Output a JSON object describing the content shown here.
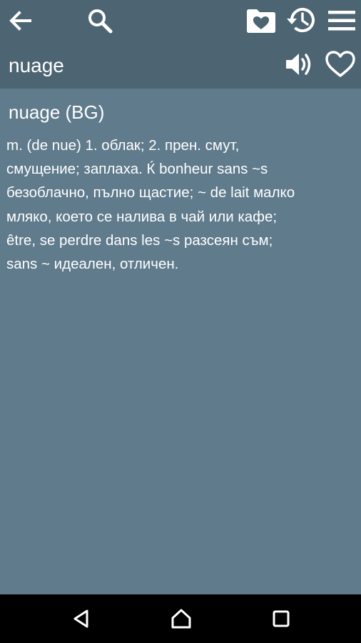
{
  "toolbar": {
    "word": "nuage",
    "icons": [
      "back-arrow-icon",
      "search-icon",
      "folder-heart-icon",
      "history-icon",
      "menu-icon",
      "speaker-icon",
      "heart-icon"
    ]
  },
  "entry": {
    "title": "nuage (BG)",
    "lines": [
      "m. (de nue) 1. облак; 2. прен. смут,",
      "смущение; заплаха. Ќ bonheur sans ~s",
      "безоблачно, пълно щастие; ~ de lait малко",
      "мляко, което се налива в чай или кафе;",
      "être, se perdre dans les ~s разсеян съм;",
      "sans ~ идеален, отличен."
    ]
  },
  "nav": {
    "icons": [
      "back-triangle-icon",
      "home-icon",
      "recents-icon"
    ]
  },
  "colors": {
    "toolbar_bg": "#4d6472",
    "content_bg": "#5f7b8c",
    "text": "#ffffff",
    "navbar_bg": "#000000"
  }
}
